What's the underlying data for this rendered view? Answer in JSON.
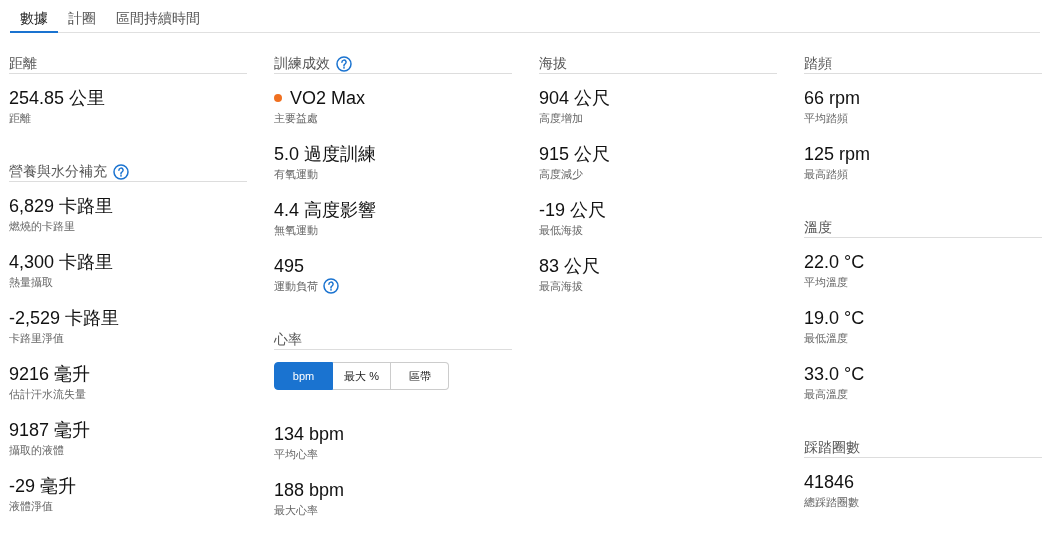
{
  "tabs": [
    {
      "label": "數據",
      "selected": true
    },
    {
      "label": "計圈",
      "selected": false
    },
    {
      "label": "區間持續時間",
      "selected": false
    }
  ],
  "columns": [
    {
      "sections": [
        {
          "title": "距離",
          "help": false,
          "stats": [
            {
              "value": "254.85 公里",
              "label": "距離"
            }
          ]
        },
        {
          "title": "營養與水分補充",
          "help": true,
          "stats": [
            {
              "value": "6,829 卡路里",
              "label": "燃燒的卡路里"
            },
            {
              "value": "4,300 卡路里",
              "label": "熱量攝取"
            },
            {
              "value": "-2,529 卡路里",
              "label": "卡路里淨值"
            },
            {
              "value": "9216 毫升",
              "label": "估計汗水流失量"
            },
            {
              "value": "9187 毫升",
              "label": "攝取的液體"
            },
            {
              "value": "-29 毫升",
              "label": "液體淨值"
            }
          ]
        }
      ]
    },
    {
      "sections": [
        {
          "title": "訓練成效",
          "help": true,
          "stats": [
            {
              "value": "VO2 Max",
              "label": "主要益處",
              "color": "#f07020"
            },
            {
              "value": "5.0 過度訓練",
              "label": "有氧運動"
            },
            {
              "value": "4.4 高度影響",
              "label": "無氧運動"
            },
            {
              "value": "495",
              "label": "運動負荷",
              "help": true
            }
          ]
        },
        {
          "title": "心率",
          "help": false,
          "toggle": [
            {
              "label": "bpm",
              "selected": true
            },
            {
              "label": "最大 %",
              "selected": false
            },
            {
              "label": "區帶",
              "selected": false
            }
          ],
          "stats": [
            {
              "value": "134 bpm",
              "label": "平均心率"
            },
            {
              "value": "188 bpm",
              "label": "最大心率"
            }
          ]
        }
      ]
    },
    {
      "sections": [
        {
          "title": "海拔",
          "help": false,
          "stats": [
            {
              "value": "904 公尺",
              "label": "高度增加"
            },
            {
              "value": "915 公尺",
              "label": "高度減少"
            },
            {
              "value": "-19 公尺",
              "label": "最低海拔"
            },
            {
              "value": "83 公尺",
              "label": "最高海拔"
            }
          ]
        }
      ]
    },
    {
      "sections": [
        {
          "title": "踏頻",
          "help": false,
          "stats": [
            {
              "value": "66 rpm",
              "label": "平均踏頻"
            },
            {
              "value": "125 rpm",
              "label": "最高踏頻"
            }
          ]
        },
        {
          "title": "溫度",
          "help": false,
          "stats": [
            {
              "value": "22.0 °C",
              "label": "平均溫度"
            },
            {
              "value": "19.0 °C",
              "label": "最低溫度"
            },
            {
              "value": "33.0 °C",
              "label": "最高溫度"
            }
          ]
        },
        {
          "title": "踩踏圈數",
          "help": false,
          "stats": [
            {
              "value": "41846",
              "label": "總踩踏圈數"
            }
          ]
        }
      ]
    }
  ]
}
